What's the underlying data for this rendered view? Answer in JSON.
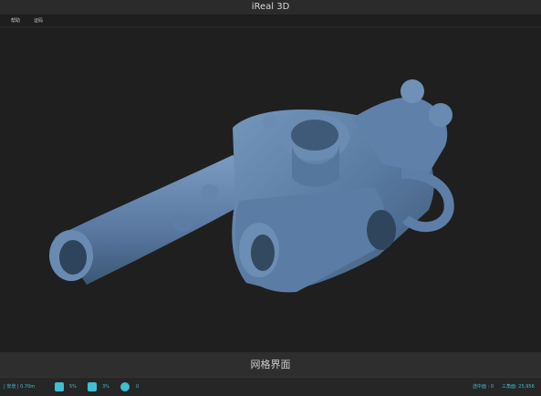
{
  "window": {
    "title": "iReal 3D"
  },
  "menu": {
    "items": [
      {
        "label": "帮助"
      },
      {
        "label": "证码"
      }
    ]
  },
  "viewport": {
    "model_color": "#5a7ca3",
    "background": "#1f1f1f"
  },
  "caption": {
    "text": "网格界面"
  },
  "status": {
    "left": {
      "distance_label": "| 安增 | 0.70m",
      "item1_value": "5%",
      "item2_value": "3%",
      "item3_value": "0"
    },
    "right": {
      "points_label": "选中面 : 0",
      "mesh_label": "三角面: 25,956"
    },
    "accent_color": "#3fbfcf"
  }
}
